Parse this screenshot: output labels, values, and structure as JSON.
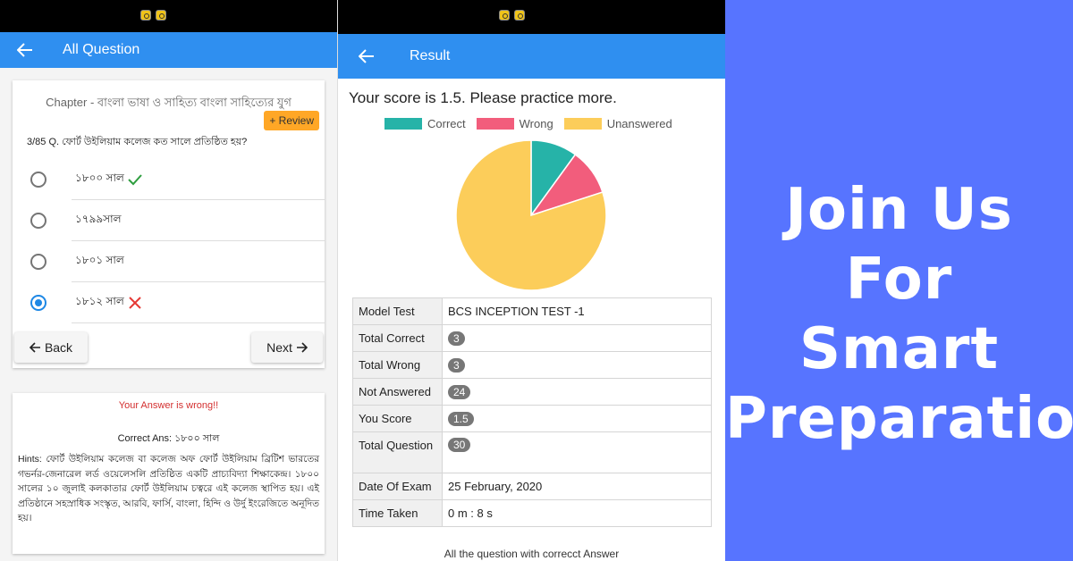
{
  "panel1": {
    "appbar_title": "All Question",
    "chapter": "Chapter - বাংলা ভাষা ও সাহিত্য বাংলা সাহিত্যের যুগ",
    "review_label": "+ Review",
    "question": "3/85 Q. ফোর্ট উইলিয়াম কলেজ কত সালে প্রতিষ্ঠিত হয়?",
    "options": [
      {
        "label": "১৮০০ সাল",
        "mark": "check-icon",
        "selected": false
      },
      {
        "label": "১৭৯৯সাল",
        "mark": "",
        "selected": false
      },
      {
        "label": "১৮০১ সাল",
        "mark": "",
        "selected": false
      },
      {
        "label": "১৮১২ সাল",
        "mark": "cross-icon",
        "selected": true
      }
    ],
    "back_label": "Back",
    "next_label": "Next",
    "answer_status": "Your Answer is wrong!!",
    "correct_answer": "Correct Ans: ১৮০০ সাল",
    "hints": "Hints: ফোর্ট উইলিয়াম কলেজ বা কলেজ অফ ফোর্ট উইলিয়াম ব্রিটিশ ভারতের গভর্নর-জেনারেল লর্ড ওয়েলেসলি প্রতিষ্ঠিত একটি প্রাচ্যবিদ্যা শিক্ষাকেন্দ্র। ১৮০০ সালের ১০ জুলাই কলকাতার ফোর্ট উইলিয়াম চত্বরে এই কলেজ স্থাপিত হয়। এই প্রতিষ্ঠানে সহস্রাধিক সংস্কৃত, আরবি, ফার্সি, বাংলা, হিন্দি ও উর্দু ইংরেজিতে অনূদিত হয়।"
  },
  "panel2": {
    "appbar_title": "Result",
    "score_text": "Your score is 1.5. Please practice more.",
    "rows": [
      {
        "key": "Model Test",
        "value": "BCS INCEPTION TEST -1",
        "pill": false
      },
      {
        "key": "Total Correct",
        "value": "3",
        "pill": true
      },
      {
        "key": "Total Wrong",
        "value": "3",
        "pill": true
      },
      {
        "key": "Not Answered",
        "value": "24",
        "pill": true
      },
      {
        "key": "You Score",
        "value": "1.5",
        "pill": true
      },
      {
        "key": "Total Question",
        "value": "30",
        "pill": true
      },
      {
        "key": "Date Of Exam",
        "value": "25 February, 2020",
        "pill": false
      },
      {
        "key": "Time Taken",
        "value": "0 m : 8 s",
        "pill": false
      }
    ],
    "footer": "All the question with correcct Answer"
  },
  "chart_data": {
    "type": "pie",
    "labels": [
      "Correct",
      "Wrong",
      "Unanswered"
    ],
    "values": [
      3,
      3,
      24
    ],
    "colors": [
      "#26b3a8",
      "#f25d7c",
      "#fccd5a"
    ],
    "legend_position": "top"
  },
  "panel3": {
    "promo_lines": [
      "Join Us",
      "For",
      "Smart",
      "Preparation"
    ]
  },
  "colors": {
    "appbar": "#2f8ff0",
    "promo_bg": "#5774ff",
    "review": "#ffa726",
    "wrong_text": "#d32f2f"
  }
}
